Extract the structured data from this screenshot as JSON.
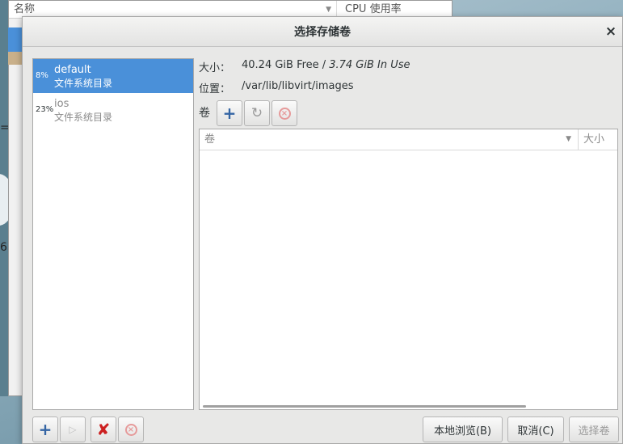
{
  "background_window": {
    "col_name": "名称",
    "col_cpu": "CPU 使用率",
    "glyph1": "=",
    "glyph2": "6."
  },
  "dialog": {
    "title": "选择存储卷",
    "close": "×"
  },
  "pools": [
    {
      "usage": "8%",
      "name": "default",
      "type": "文件系统目录",
      "selected": true
    },
    {
      "usage": "23%",
      "name": "ios",
      "type": "文件系统目录",
      "selected": false
    }
  ],
  "info": {
    "size_label": "大小：",
    "size_free": "40.24 GiB Free /",
    "size_inuse": "3.74 GiB In Use",
    "location_label": "位置：",
    "location_value": "/var/lib/libvirt/images"
  },
  "volumes": {
    "label": "卷",
    "header_name": "卷",
    "header_size": "大小",
    "rows": []
  },
  "buttons": {
    "browse_local": "本地浏览(B)",
    "cancel": "取消(C)",
    "choose_volume": "选择卷"
  },
  "icons": {
    "add": "add-icon",
    "refresh": "refresh-icon",
    "stop": "stop-icon",
    "start": "play-icon",
    "delete": "delete-icon"
  },
  "colors": {
    "selection": "#4a90d9",
    "accent": "#3465a4",
    "danger": "#cc2020"
  }
}
